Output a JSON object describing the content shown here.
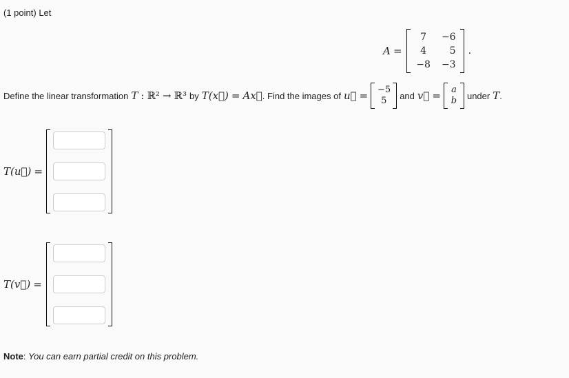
{
  "intro": {
    "points": "(1 point)",
    "let": "Let"
  },
  "matrix_a": {
    "label": "A",
    "equals": "=",
    "rows": [
      [
        "7",
        "−6"
      ],
      [
        "4",
        "5"
      ],
      [
        "−8",
        "−3"
      ]
    ],
    "trailing": "."
  },
  "definition": {
    "text1": "Define the linear transformation",
    "T": "T",
    "colon": ":",
    "domain": "ℝ²",
    "arrow": "→",
    "codomain": "ℝ³",
    "by": "by",
    "Tx": "T(x⃗)",
    "eq": "=",
    "Ax": "Ax⃗",
    "text2": ". Find the images of",
    "u_label": "u⃗",
    "u_vector": [
      "−5",
      "5"
    ],
    "and": "and",
    "v_label": "v⃗",
    "v_vector": [
      "a",
      "b"
    ],
    "under": "under",
    "under_T": "T",
    "end": "."
  },
  "answers": {
    "u": {
      "label": "T(u⃗)",
      "equals": "=",
      "fields": [
        "",
        "",
        ""
      ]
    },
    "v": {
      "label": "T(v⃗)",
      "equals": "=",
      "fields": [
        "",
        "",
        ""
      ]
    }
  },
  "note": {
    "label": "Note",
    "colon": ":",
    "text": "You can earn partial credit on this problem."
  }
}
